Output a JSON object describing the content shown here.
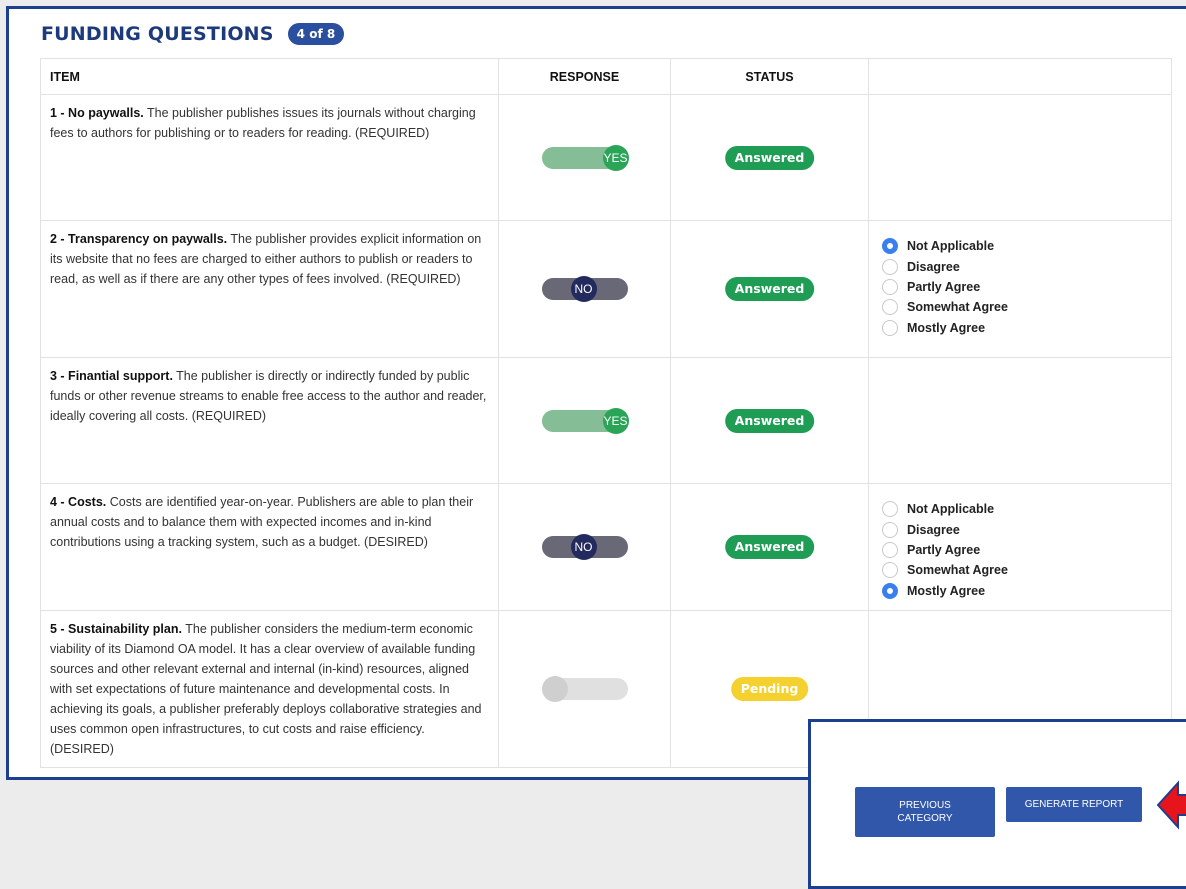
{
  "header": {
    "title": "FUNDING QUESTIONS",
    "count": "4 of 8"
  },
  "table": {
    "columns": {
      "item": "ITEM",
      "response": "RESPONSE",
      "status": "STATUS",
      "extra": ""
    },
    "rows": [
      {
        "title": "1 - No paywalls.",
        "body": " The publisher publishes issues its journals without charging fees to authors for publishing or to readers for reading. (REQUIRED)",
        "response": "YES",
        "response_state": "yes",
        "status": "Answered"
      },
      {
        "title": "2 - Transparency on paywalls.",
        "body": " The publisher provides explicit information on its website that no fees are charged to either authors to publish or readers to read, as well as if there are any other types of fees involved. (REQUIRED)",
        "response": "NO",
        "response_state": "no",
        "status": "Answered",
        "options": [
          "Not Applicable",
          "Disagree",
          "Partly Agree",
          "Somewhat Agree",
          "Mostly Agree"
        ],
        "selected_option": "Not Applicable"
      },
      {
        "title": "3 - Finantial support.",
        "body": " The publisher is directly or indirectly funded by public funds or other revenue streams to enable free access to the author and reader, ideally covering all costs. (REQUIRED)",
        "response": "YES",
        "response_state": "yes",
        "status": "Answered"
      },
      {
        "title": "4 - Costs.",
        "body": " Costs are identified year-on-year. Publishers are able to plan their annual costs and to balance them with expected incomes and in-kind contributions using a tracking system, such as a budget. (DESIRED)",
        "response": "NO",
        "response_state": "no",
        "status": "Answered",
        "options": [
          "Not Applicable",
          "Disagree",
          "Partly Agree",
          "Somewhat Agree",
          "Mostly Agree"
        ],
        "selected_option": "Mostly Agree"
      },
      {
        "title": "5 - Sustainability plan.",
        "body": " The publisher considers the medium-term economic viability of its Diamond OA model. It has a clear overview of available funding sources and other relevant external and internal (in-kind) resources, aligned with set expectations of future maintenance and developmental costs. In achieving its goals, a publisher preferably deploys collaborative strategies and uses common open infrastructures, to cut costs and raise efficiency. (DESIRED)",
        "response": "",
        "response_state": "off",
        "status": "Pending"
      }
    ]
  },
  "footer": {
    "prev_label": "PREVIOUS CATEGORY",
    "generate_label": "GENERATE REPORT"
  },
  "colors": {
    "accent": "#1d3f8f",
    "answered": "#1f9d55",
    "pending": "#f5d12f",
    "arrow": "#e8141b"
  }
}
